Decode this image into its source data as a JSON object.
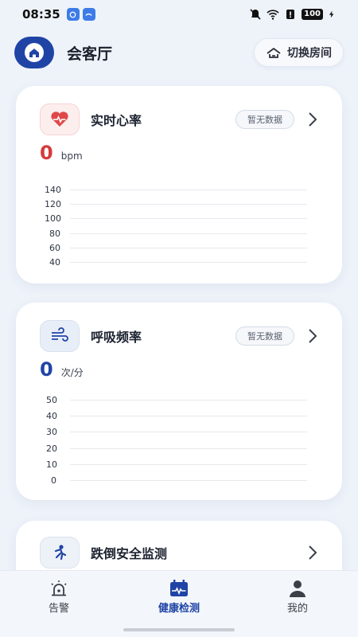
{
  "status_bar": {
    "time": "08:35",
    "battery": "100"
  },
  "header": {
    "room_name": "会客厅",
    "switch_room_label": "切换房间"
  },
  "heart_rate": {
    "title": "实时心率",
    "badge": "暂无数据",
    "value": "0",
    "unit": "bpm",
    "value_color": "#d63a3a",
    "ticks": [
      "140",
      "120",
      "100",
      "80",
      "60",
      "40"
    ]
  },
  "breathing": {
    "title": "呼吸频率",
    "badge": "暂无数据",
    "value": "0",
    "unit": "次/分",
    "value_color": "#1f44a6",
    "ticks": [
      "50",
      "40",
      "30",
      "20",
      "10",
      "0"
    ]
  },
  "fall_detection": {
    "title": "跌倒安全监测"
  },
  "bottom_nav": {
    "items": [
      {
        "label": "告警",
        "icon": "alarm-icon",
        "active": false
      },
      {
        "label": "健康检测",
        "icon": "health-calendar-icon",
        "active": true
      },
      {
        "label": "我的",
        "icon": "person-icon",
        "active": false
      }
    ]
  },
  "colors": {
    "accent": "#1f44a6",
    "heart_bg": "#fdeeee",
    "heart_icon": "#e04848",
    "breath_bg": "#e8eef8"
  }
}
